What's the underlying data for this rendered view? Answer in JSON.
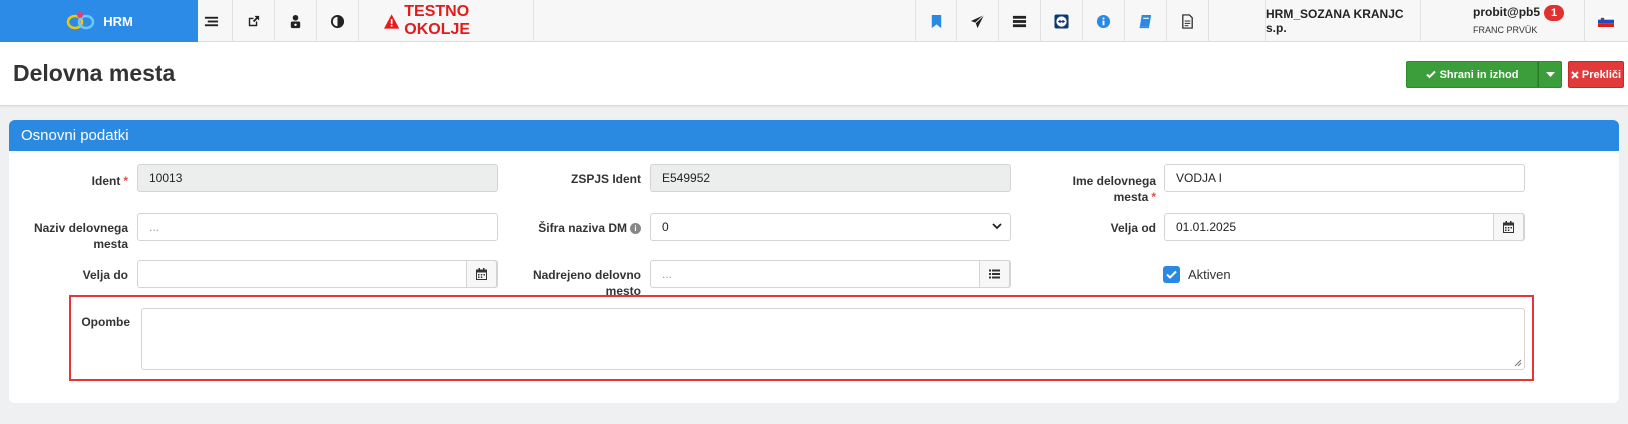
{
  "app": {
    "logo_text": "HRM",
    "environment": "TESTNO OKOLJE",
    "company": "HRM_SOZANA KRANJC s.p.",
    "user": {
      "username": "probit@pb5",
      "full_name": "FRANC PRVÜK",
      "notifications": "1"
    },
    "toolbar_left_icons": [
      "list-icon",
      "external-link-icon",
      "user-lock-icon",
      "contrast-icon"
    ],
    "toolbar_right_icons": [
      "bookmark-icon",
      "send-icon",
      "server-icon",
      "teamviewer-icon",
      "info-icon",
      "book-icon",
      "document-icon"
    ]
  },
  "page": {
    "title": "Delovna mesta",
    "save_button": "Shrani in izhod",
    "cancel_button": "Prekliči"
  },
  "panel": {
    "title": "Osnovni podatki",
    "fields": {
      "ident": {
        "label": "Ident",
        "value": "10013"
      },
      "zspjs_ident": {
        "label": "ZSPJS Ident",
        "value": "E549952"
      },
      "ime_delovnega_mesta": {
        "label": "Ime delovnega mesta",
        "value": "VODJA I"
      },
      "naziv_delovnega_mesta": {
        "label": "Naziv delovnega mesta",
        "placeholder": "..."
      },
      "sifra_naziva_dm": {
        "label": "Šifra naziva DM",
        "value": "0"
      },
      "velja_od": {
        "label": "Velja od",
        "value": "01.01.2025"
      },
      "velja_do": {
        "label": "Velja do",
        "value": ""
      },
      "nadrejeno_delovno_mesto": {
        "label": "Nadrejeno delovno mesto",
        "placeholder": "..."
      },
      "aktiven": {
        "label": "Aktiven",
        "checked": true
      },
      "opombe": {
        "label": "Opombe",
        "value": ""
      }
    }
  },
  "colors": {
    "primary": "#2a89e0",
    "success": "#3b9e3a",
    "danger": "#e03a3a",
    "env_warning": "#e21b1b"
  }
}
